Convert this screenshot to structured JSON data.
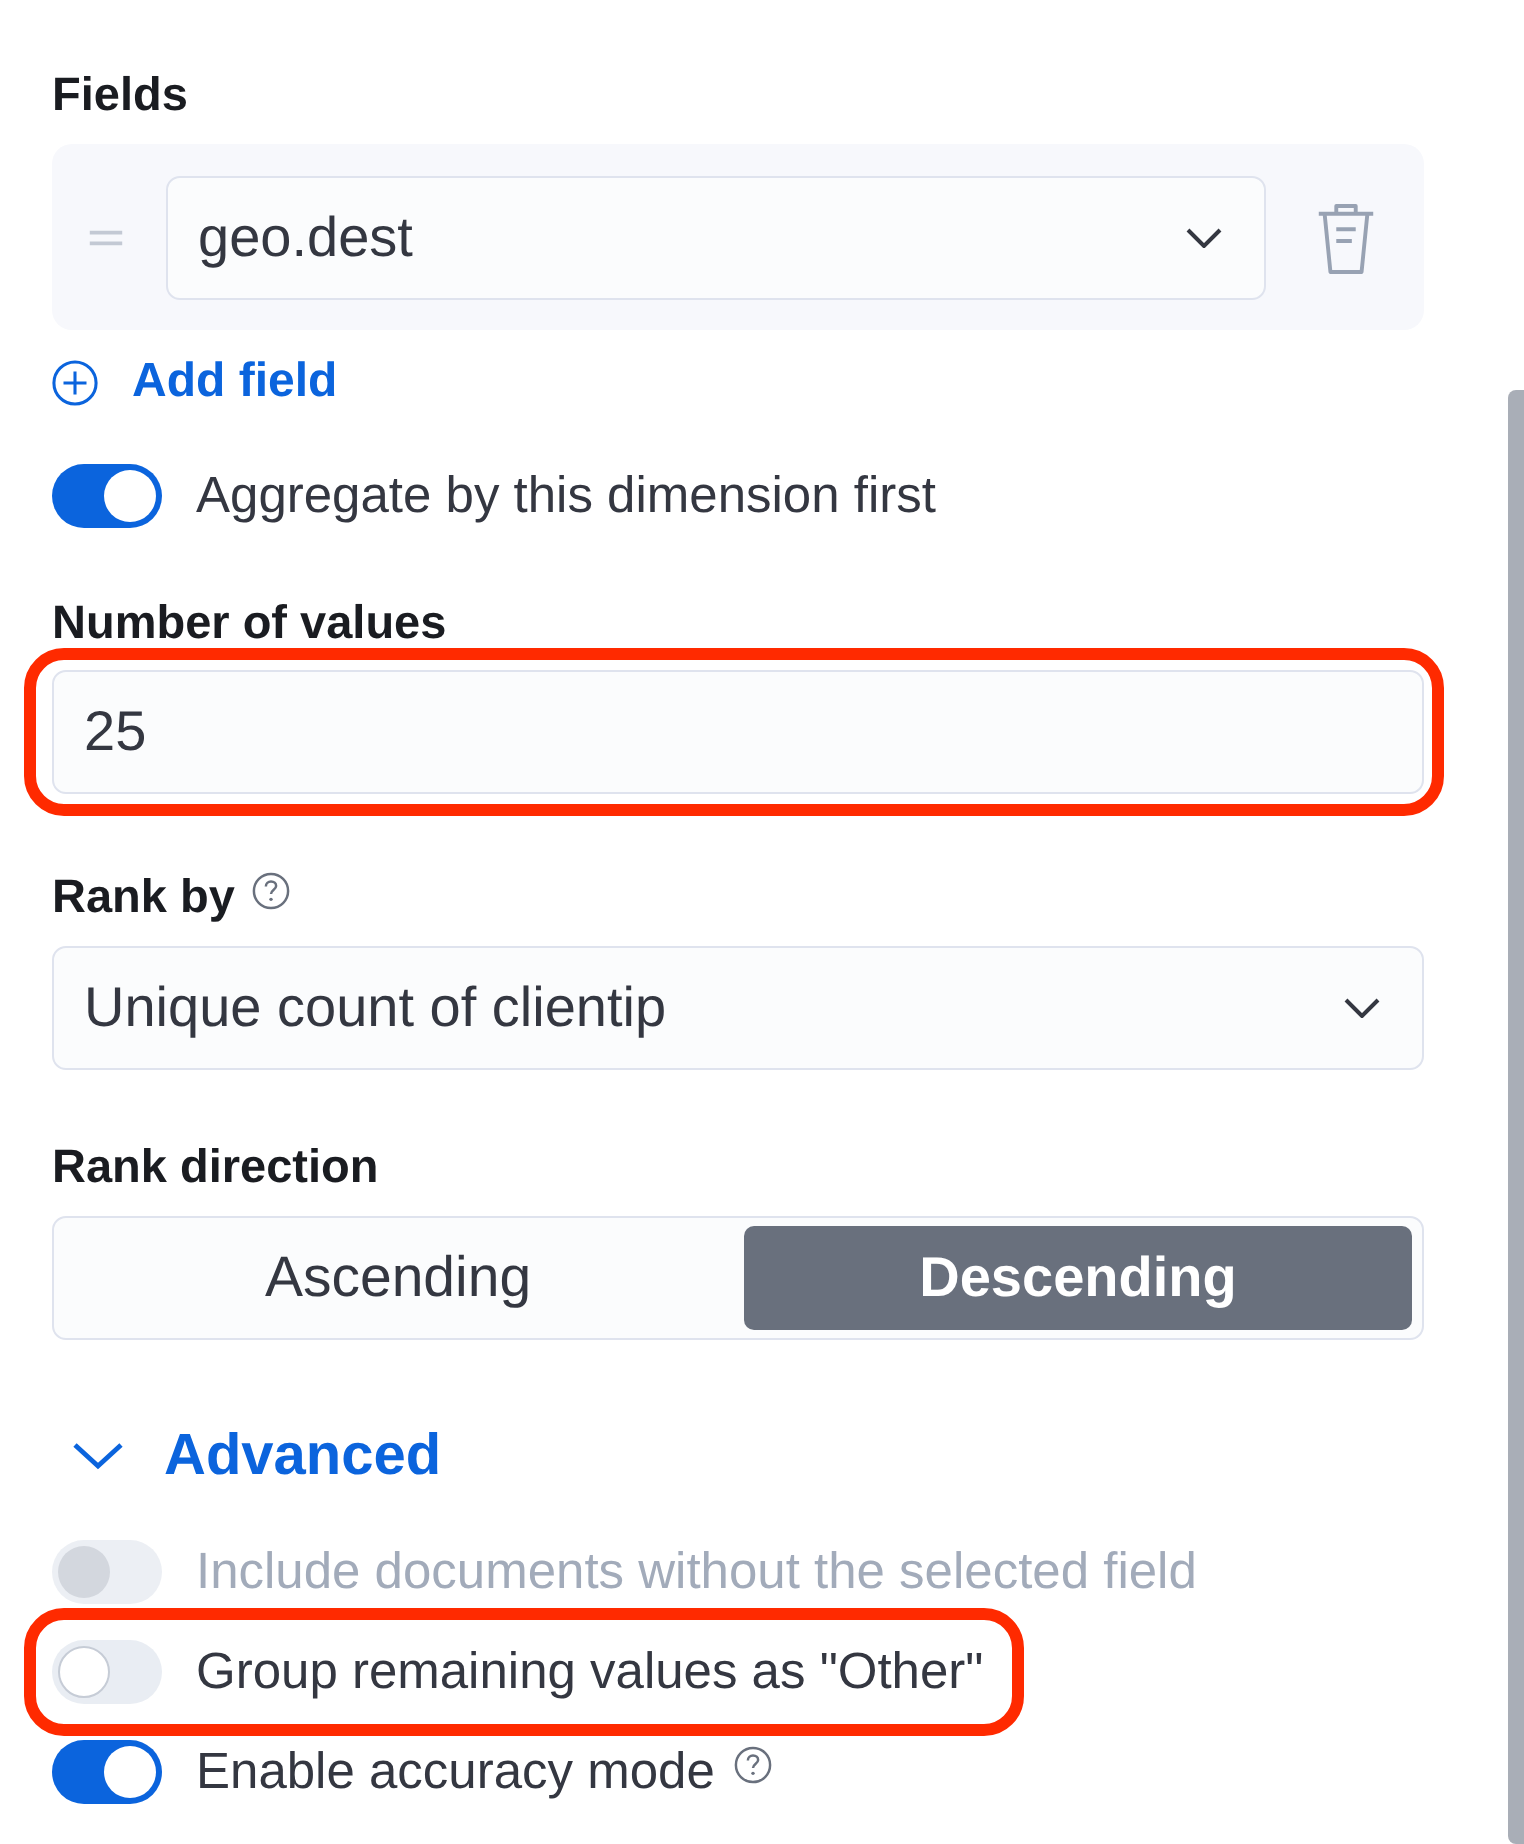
{
  "fields": {
    "label": "Fields",
    "items": [
      {
        "value": "geo.dest"
      }
    ],
    "add_label": "Add field"
  },
  "dimension_toggle": {
    "label": "Aggregate by this dimension first",
    "on": true,
    "disabled": false
  },
  "number_of_values": {
    "label": "Number of values",
    "value": "25",
    "highlighted": true
  },
  "rank_by": {
    "label": "Rank by",
    "help": true,
    "value": "Unique count of clientip"
  },
  "rank_direction": {
    "label": "Rank direction",
    "options": [
      {
        "label": "Ascending",
        "selected": false
      },
      {
        "label": "Descending",
        "selected": true
      }
    ]
  },
  "advanced": {
    "label": "Advanced",
    "expanded": true,
    "toggles": [
      {
        "label": "Include documents without the selected field",
        "on": false,
        "disabled": true,
        "highlighted": false,
        "help": false
      },
      {
        "label": "Group remaining values as \"Other\"",
        "on": false,
        "disabled": false,
        "highlighted": true,
        "help": false
      },
      {
        "label": "Enable accuracy mode",
        "on": true,
        "disabled": false,
        "highlighted": false,
        "help": true
      }
    ]
  }
}
